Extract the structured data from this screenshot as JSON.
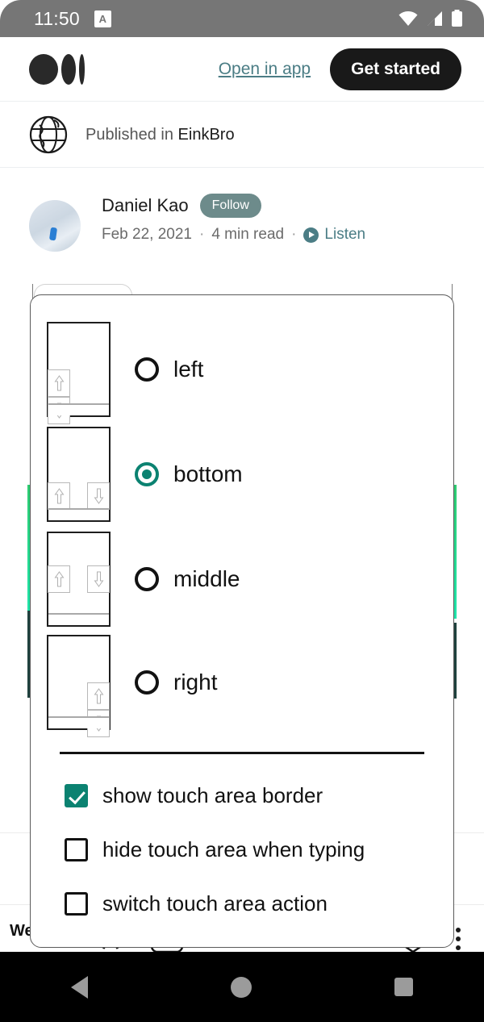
{
  "status_bar": {
    "time": "11:50",
    "badge_label": "A",
    "icons": [
      "wifi-icon",
      "cell-signal-icon",
      "battery-icon"
    ]
  },
  "top_bar": {
    "logo_name": "medium-logo",
    "open_in_app": "Open in app",
    "get_started": "Get started",
    "link_color": "#4b7d85",
    "button_bg": "#191919"
  },
  "publication": {
    "icon": "globe-icon",
    "prefix": "Published in ",
    "name": "EinkBro"
  },
  "article": {
    "author": "Daniel Kao",
    "follow_label": "Follow",
    "date": "Feb 22, 2021",
    "read_time": "4 min read",
    "listen_label": "Listen",
    "separator": "·",
    "follow_pill_color": "#6d8b8b"
  },
  "background": {
    "welcome_text": "Wel",
    "overflow_menu": "more-options-icon",
    "accent_green": "#2ecc71",
    "accent_teal": "#1fe6ad",
    "accent_dark": "#20423f"
  },
  "dialog": {
    "accent_color": "#0b8271",
    "options": [
      {
        "id": "left",
        "label": "left",
        "selected": false,
        "layout": "stacked-left"
      },
      {
        "id": "bottom",
        "label": "bottom",
        "selected": true,
        "layout": "split-bottom"
      },
      {
        "id": "middle",
        "label": "middle",
        "selected": false,
        "layout": "split-middle"
      },
      {
        "id": "right",
        "label": "right",
        "selected": false,
        "layout": "stacked-right"
      }
    ],
    "checkboxes": [
      {
        "id": "show-touch-area-border",
        "label": "show touch area border",
        "checked": true
      },
      {
        "id": "hide-touch-area-typing",
        "label": "hide touch area when typing",
        "checked": false
      },
      {
        "id": "switch-touch-area-action",
        "label": "switch touch area action",
        "checked": false
      }
    ]
  },
  "nav_bar": {
    "back": "back-icon",
    "home": "home-icon",
    "recents": "recents-icon"
  }
}
